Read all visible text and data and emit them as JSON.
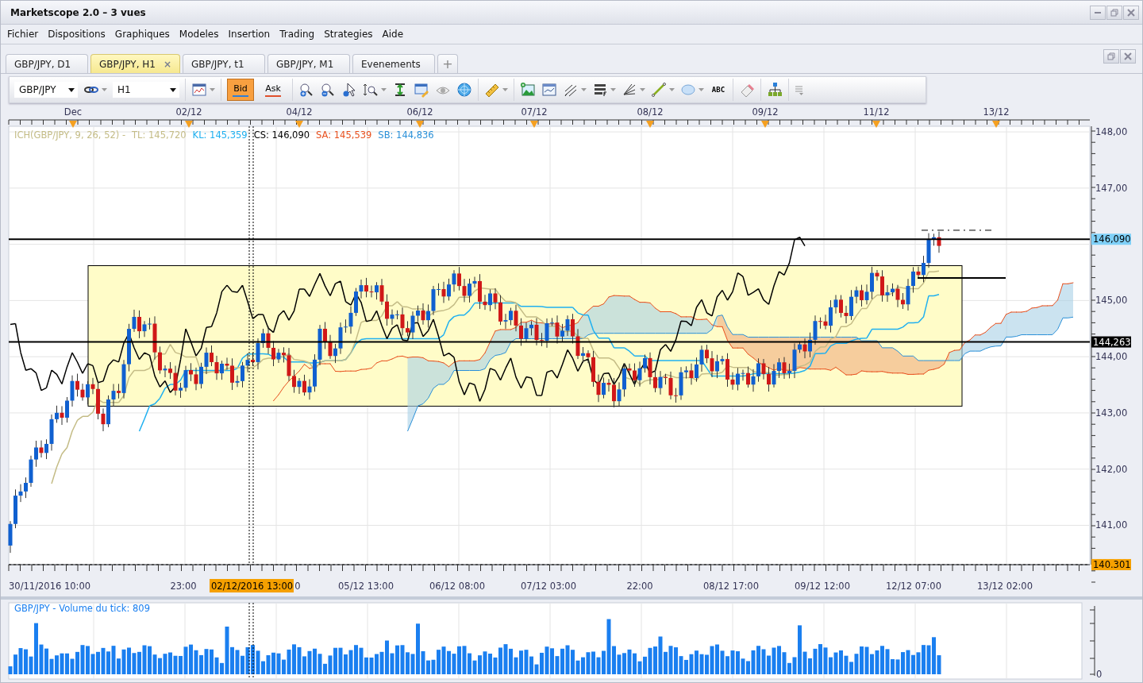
{
  "window": {
    "title": "Marketscope 2.0 – 3 vues"
  },
  "menu": [
    "Fichier",
    "Dispositions",
    "Graphiques",
    "Modeles",
    "Insertion",
    "Trading",
    "Strategies",
    "Aide"
  ],
  "tabs": [
    {
      "label": "GBP/JPY, D1",
      "selected": false
    },
    {
      "label": "GBP/JPY, H1",
      "selected": true,
      "close": "×"
    },
    {
      "label": "GBP/JPY, t1",
      "selected": false
    },
    {
      "label": "GBP/JPY, M1",
      "selected": false
    },
    {
      "label": "Evenements",
      "selected": false
    }
  ],
  "new_tab": "+",
  "toolbar": {
    "symbol": "GBP/JPY",
    "timeframe": "H1",
    "price_buttons": [
      {
        "label": "Bid",
        "selected": true,
        "color": "#2f7fd8"
      },
      {
        "label": "Ask",
        "selected": false,
        "color": "#e0502c"
      }
    ],
    "text_tool": "ABC"
  },
  "chart": {
    "date_labels": [
      "Dec",
      "02/12",
      "04/12",
      "06/12",
      "07/12",
      "08/12",
      "09/12",
      "11/12",
      "13/12"
    ],
    "legend": {
      "title": "ICH(GBP/JPY, 9, 26, 52) -",
      "items": [
        {
          "label": "TL: 145,720",
          "color": "#c4bc86"
        },
        {
          "label": "KL: 145,359",
          "color": "#1fb0f0"
        },
        {
          "label": "CS: 146,090",
          "color": "#000000"
        },
        {
          "label": "SA: 145,539",
          "color": "#e8501e"
        },
        {
          "label": "SB: 144,836",
          "color": "#2a90d8"
        }
      ]
    },
    "price_tags": [
      {
        "kind": "current",
        "label": "146,090"
      },
      {
        "kind": "line",
        "label": "144,263"
      },
      {
        "kind": "low",
        "label": "140.301"
      }
    ],
    "time_labels": [
      "30/11/2016 10:00",
      "23:00",
      "0",
      "05/12 13:00",
      "06/12 08:00",
      "07/12 03:00",
      "22:00",
      "08/12 17:00",
      "09/12 12:00",
      "12/12 07:00",
      "13/12 02:00"
    ],
    "price_labels": [
      "148,00",
      "147,00",
      "145,00",
      "144,00",
      "143,00",
      "142,00",
      "141,00"
    ],
    "crosshair_time": "02/12/2016 13:00"
  },
  "volume": {
    "legend": "GBP/JPY - Volume du tick: 809",
    "axis_label": "0"
  }
}
